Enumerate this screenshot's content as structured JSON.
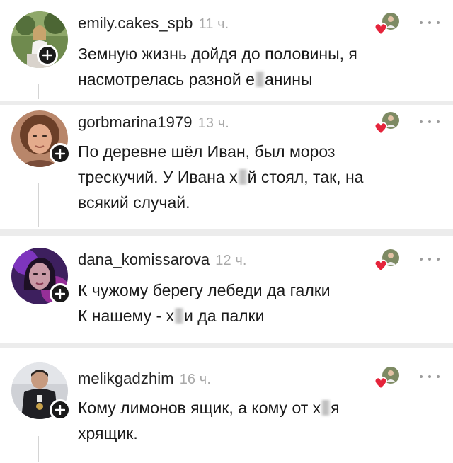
{
  "comments": [
    {
      "username": "emily.cakes_spb",
      "time": "11 ч.",
      "text_before": "Земную жизнь дойдя до половины, я насмотрелась разной е",
      "text_after": "анины",
      "avatar": "woman-in-garden-photo"
    },
    {
      "username": "gorbmarina1979",
      "time": "13 ч.",
      "text_before": "По деревне шёл Иван, был мороз трескучий. У Ивана х",
      "text_after": "й стоял, так, на всякий случай.",
      "avatar": "woman-portrait-photo"
    },
    {
      "username": "dana_komissarova",
      "time": "12 ч.",
      "text_before": "К чужому берегу лебеди да галки",
      "line2_before": "К нашему - х",
      "line2_after": "и да палки",
      "avatar": "woman-purple-light-photo"
    },
    {
      "username": "melikgadzhim",
      "time": "16 ч.",
      "text_before": "Кому лимонов ящик, а кому от х",
      "text_after": "я хрящик.",
      "avatar": "man-dark-outfit-photo"
    }
  ],
  "icons": {
    "add": "plus-icon",
    "reaction": "author-liked-heart-icon",
    "more": "more-dots-icon"
  },
  "colors": {
    "heart": "#e5243b",
    "username": "#222222",
    "time": "#a9a9a9",
    "background": "#ececec"
  }
}
